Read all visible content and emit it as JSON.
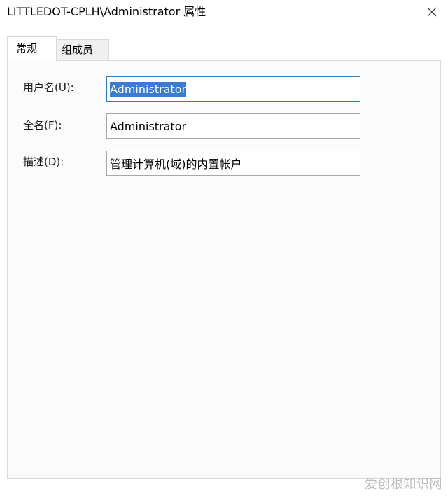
{
  "window": {
    "title": "LITTLEDOT-CPLH\\Administrator 属性"
  },
  "tabs": [
    {
      "label": "常规",
      "selected": true
    },
    {
      "label": "组成员",
      "selected": false
    }
  ],
  "fields": {
    "username": {
      "label": "用户名(U):",
      "value": "Administrator"
    },
    "fullname": {
      "label": "全名(F):",
      "value": "Administrator"
    },
    "description": {
      "label": "描述(D):",
      "value": "管理计算机(域)的内置帐户"
    }
  },
  "icons": {
    "close": "close-icon"
  },
  "watermark": "爱创根知识网",
  "colors": {
    "selection": "#3a7cd1",
    "focus_border": "#2f7fbf",
    "panel_background": "#fbfbfb",
    "inactive_tab": "#f0f0f0"
  }
}
